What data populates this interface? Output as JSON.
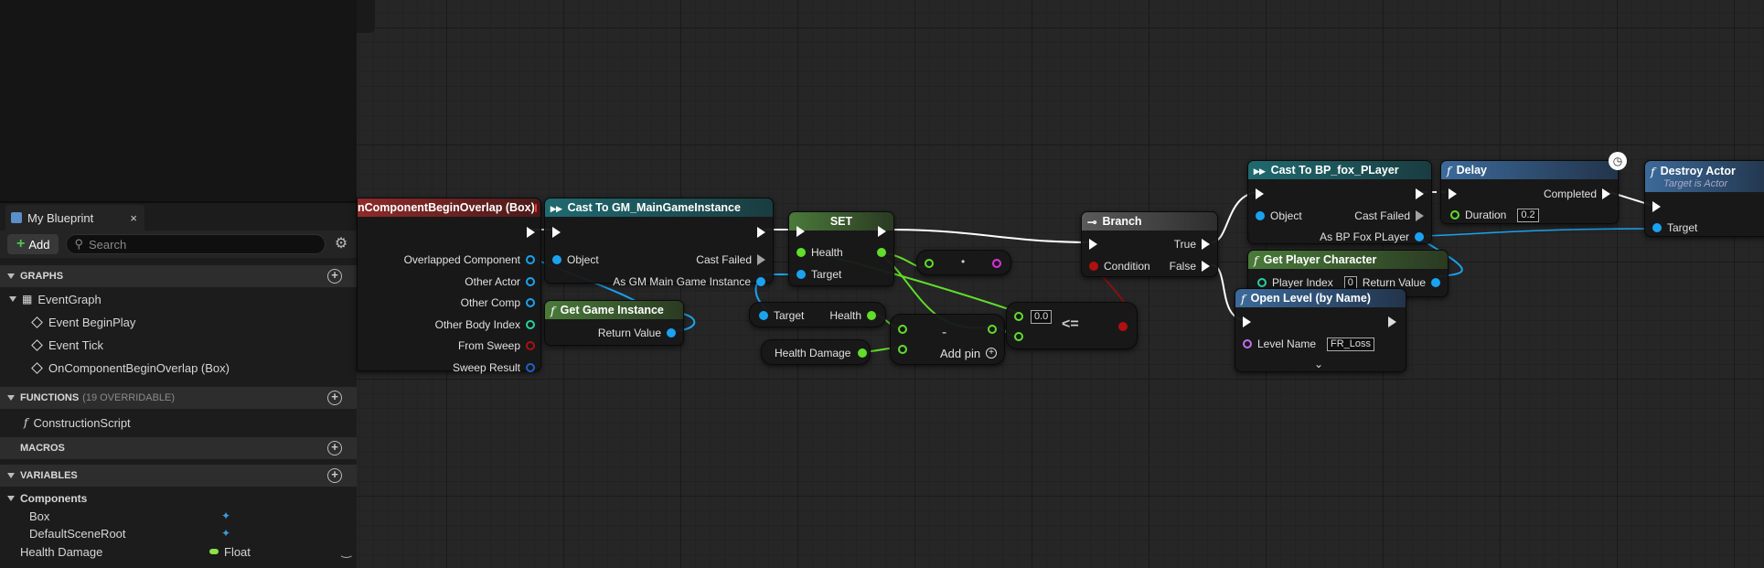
{
  "left_panel": {
    "tab_title": "My Blueprint",
    "close_glyph": "×",
    "add_label": "Add",
    "search_placeholder": "Search",
    "sections": {
      "graphs": "GRAPHS",
      "functions": "FUNCTIONS",
      "functions_sub": "(19 OVERRIDABLE)",
      "macros": "MACROS",
      "variables": "VARIABLES"
    },
    "graphs": {
      "event_graph": "EventGraph",
      "events": [
        "Event BeginPlay",
        "Event Tick",
        "OnComponentBeginOverlap (Box)"
      ]
    },
    "functions": [
      "ConstructionScript"
    ],
    "variables": {
      "components_label": "Components",
      "components": [
        "Box",
        "DefaultSceneRoot"
      ],
      "health_damage": {
        "name": "Health Damage",
        "type": "Float"
      }
    }
  },
  "nodes": {
    "overlap": {
      "title": "nComponentBeginOverlap (Box)",
      "pins": [
        "Overlapped Component",
        "Other Actor",
        "Other Comp",
        "Other Body Index",
        "From Sweep",
        "Sweep Result"
      ]
    },
    "cast_gm": {
      "title": "Cast To GM_MainGameInstance",
      "object": "Object",
      "cast_failed": "Cast Failed",
      "as_out": "As GM Main Game Instance"
    },
    "get_game_instance": {
      "title": "Get Game Instance",
      "return": "Return Value"
    },
    "set": {
      "title": "SET",
      "health": "Health",
      "target": "Target"
    },
    "get_health": {
      "target": "Target",
      "health": "Health"
    },
    "health_damage": {
      "label": "Health Damage"
    },
    "subtract": {
      "symbol": "-",
      "add_pin": "Add pin"
    },
    "compare": {
      "value": "0.0",
      "symbol": "<="
    },
    "branch": {
      "title": "Branch",
      "true": "True",
      "false": "False",
      "condition": "Condition"
    },
    "cast_fox": {
      "title": "Cast To BP_fox_PLayer",
      "object": "Object",
      "cast_failed": "Cast Failed",
      "as_out": "As BP Fox PLayer"
    },
    "get_player_character": {
      "title": "Get Player Character",
      "player_index": "Player Index",
      "player_index_value": "0",
      "return": "Return Value"
    },
    "delay": {
      "title": "Delay",
      "completed": "Completed",
      "duration": "Duration",
      "duration_value": "0.2"
    },
    "destroy": {
      "title": "Destroy Actor",
      "subtitle": "Target is Actor",
      "target": "Target"
    },
    "open_level": {
      "title": "Open Level (by Name)",
      "level_name": "Level Name",
      "level_value": "FR_Loss"
    }
  },
  "colors": {
    "exec": "#ffffff",
    "object": "#1aa3f0",
    "float": "#61dd2a",
    "bool": "#b01010",
    "int": "#2ad0a0",
    "name": "#c070f0"
  }
}
